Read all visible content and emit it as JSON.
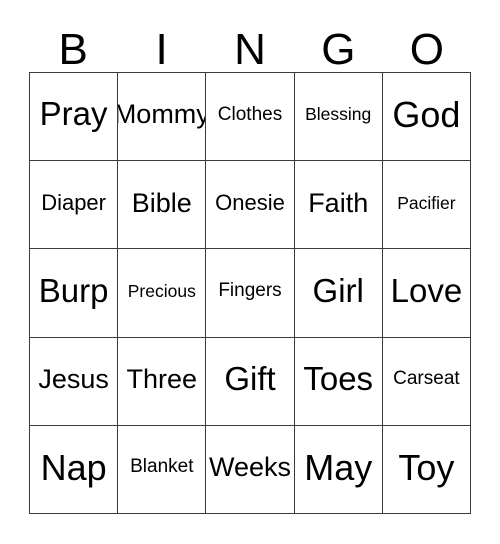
{
  "card": {
    "header_letters": [
      "B",
      "I",
      "N",
      "G",
      "O"
    ],
    "columns": 5,
    "rows": 5,
    "border_color": "#3a3a3a",
    "background_color": "#ffffff",
    "text_color": "#000000",
    "grid": [
      [
        "Pray",
        "Mommy",
        "Clothes",
        "Blessing",
        "God"
      ],
      [
        "Diaper",
        "Bible",
        "Onesie",
        "Faith",
        "Pacifier"
      ],
      [
        "Burp",
        "Precious",
        "Fingers",
        "Girl",
        "Love"
      ],
      [
        "Jesus",
        "Three",
        "Gift",
        "Toes",
        "Carseat"
      ],
      [
        "Nap",
        "Blanket",
        "Weeks",
        "May",
        "Toy"
      ]
    ]
  }
}
